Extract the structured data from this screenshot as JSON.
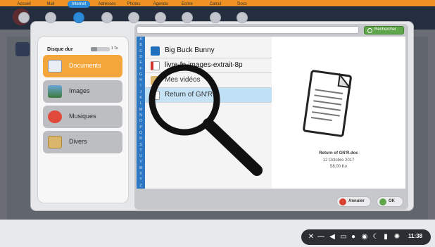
{
  "dialog": {
    "disk": {
      "label": "Disque dur",
      "size": "1 To",
      "used_fraction": 0.35
    },
    "categories": [
      {
        "label": "Documents",
        "icon": "documents-icon",
        "active": true
      },
      {
        "label": "Images",
        "icon": "images-icon",
        "active": false
      },
      {
        "label": "Musiques",
        "icon": "music-icon",
        "active": false
      },
      {
        "label": "Divers",
        "icon": "folder-icon",
        "active": false
      }
    ],
    "search_label": "Rechercher",
    "alphabet": [
      "A",
      "B",
      "C",
      "D",
      "E",
      "F",
      "G",
      "H",
      "I",
      "J",
      "K",
      "L",
      "M",
      "N",
      "O",
      "P",
      "Q",
      "R",
      "S",
      "T",
      "U",
      "V",
      "W",
      "X",
      "Y",
      "Z"
    ],
    "files": [
      {
        "label": "Big Buck Bunny",
        "icon": "video-file-icon",
        "selected": false
      },
      {
        "label": "livre-fp-images-extrait-8p",
        "icon": "pdf-file-icon",
        "selected": false
      },
      {
        "label": "Mes vidéos",
        "icon": "folder-icon",
        "selected": false
      },
      {
        "label": "Return of GN'R",
        "icon": "document-file-icon",
        "selected": true
      }
    ],
    "preview": {
      "name": "Return of GN'R.doc",
      "date": "12 Octobre 2017",
      "size": "58,00 Ko"
    },
    "cancel_label": "Annuler",
    "ok_label": "OK"
  },
  "taskbar": {
    "items": [
      {
        "label": "Accueil",
        "active": false
      },
      {
        "label": "Mail",
        "active": false
      },
      {
        "label": "Internet",
        "active": true
      },
      {
        "label": "Adresses",
        "active": false
      },
      {
        "label": "Photos",
        "active": false
      },
      {
        "label": "Agenda",
        "active": false
      },
      {
        "label": "Ecrire",
        "active": false
      },
      {
        "label": "Calcul",
        "active": false
      },
      {
        "label": "Docs",
        "active": false
      }
    ],
    "clock": "11:38"
  },
  "colors": {
    "accent_orange": "#f5a63a",
    "selection_blue": "#bfe0f5",
    "alphabet_blue": "#2e78c3",
    "ok_green": "#5fa64b",
    "cancel_red": "#d9412e"
  }
}
